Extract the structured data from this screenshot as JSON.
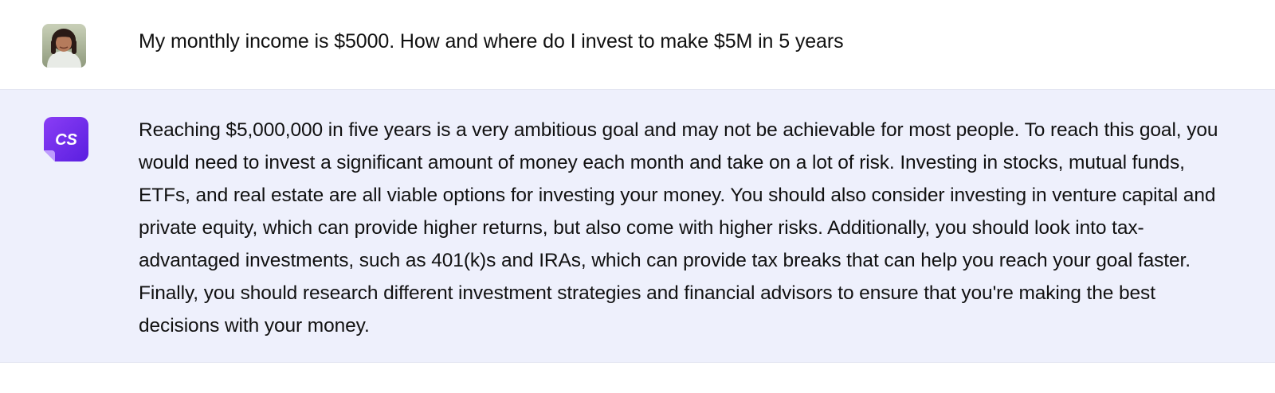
{
  "conversation": {
    "user_message": {
      "avatar_icon": "user-avatar-photo",
      "text": "My monthly income is $5000. How and where do I invest to make $5M in 5 years"
    },
    "assistant_message": {
      "avatar_icon": "cs-logo-icon",
      "avatar_label": "CS",
      "avatar_color": "#6b2cf0",
      "text": "Reaching $5,000,000 in five years is a very ambitious goal and may not be achievable for most people. To reach this goal, you would need to invest a significant amount of money each month and take on a lot of risk. Investing in stocks, mutual funds, ETFs, and real estate are all viable options for investing your money. You should also consider investing in venture capital and private equity, which can provide higher returns, but also come with higher risks. Additionally, you should look into tax-advantaged investments, such as 401(k)s and IRAs, which can provide tax breaks that can help you reach your goal faster. Finally, you should research different investment strategies and financial advisors to ensure that you're making the best decisions with your money."
    }
  }
}
